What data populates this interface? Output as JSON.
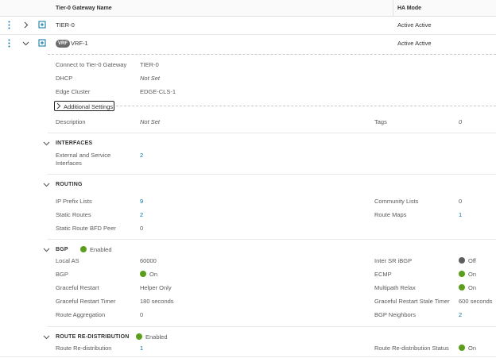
{
  "header": {
    "col_name": "Tier-0 Gateway Name",
    "col_ha": "HA Mode"
  },
  "rows": [
    {
      "name": "TIER-0",
      "ha_mode": "Active Active"
    },
    {
      "badge": "VRF",
      "name": "VRF-1",
      "ha_mode": "Active Active"
    }
  ],
  "details": {
    "connect_label": "Connect to Tier-0 Gateway",
    "connect_value": "TIER-0",
    "dhcp_label": "DHCP",
    "dhcp_value": "Not Set",
    "edge_label": "Edge Cluster",
    "edge_value": "EDGE-CLS-1",
    "additional_settings": "Additional Settings",
    "description_label": "Description",
    "description_value": "Not Set",
    "tags_label": "Tags",
    "tags_value": "0"
  },
  "interfaces": {
    "title": "INTERFACES",
    "ext_label_1": "External and Service",
    "ext_label_2": "Interfaces",
    "ext_value": "2"
  },
  "routing": {
    "title": "ROUTING",
    "ip_prefix_label": "IP Prefix Lists",
    "ip_prefix_value": "9",
    "community_label": "Community Lists",
    "community_value": "0",
    "static_routes_label": "Static Routes",
    "static_routes_value": "2",
    "route_maps_label": "Route Maps",
    "route_maps_value": "1",
    "bfd_label": "Static Route BFD Peer",
    "bfd_value": "0"
  },
  "bgp": {
    "title": "BGP",
    "status": "Enabled",
    "local_as_label": "Local AS",
    "local_as_value": "60000",
    "inter_sr_label": "Inter SR iBGP",
    "inter_sr_value": "Off",
    "bgp_label": "BGP",
    "bgp_value": "On",
    "ecmp_label": "ECMP",
    "ecmp_value": "On",
    "graceful_restart_label": "Graceful Restart",
    "graceful_restart_value": "Helper Only",
    "multipath_label": "Multipath Relax",
    "multipath_value": "On",
    "gr_timer_label": "Graceful Restart Timer",
    "gr_timer_value": "180 seconds",
    "gr_stale_label": "Graceful Restart Stale Timer",
    "gr_stale_value": "600 seconds",
    "aggregation_label": "Route Aggregation",
    "aggregation_value": "0",
    "neighbors_label": "BGP Neighbors",
    "neighbors_value": "2"
  },
  "redistribution": {
    "title": "ROUTE RE-DISTRIBUTION",
    "status": "Enabled",
    "redist_label": "Route Re-distribution",
    "redist_value": "1",
    "redist_status_label": "Route Re-distribution Status",
    "redist_status_value": "On"
  },
  "colors": {
    "green": "#5a9e1c",
    "link": "#0072a3",
    "off": "#5d5d5d"
  }
}
